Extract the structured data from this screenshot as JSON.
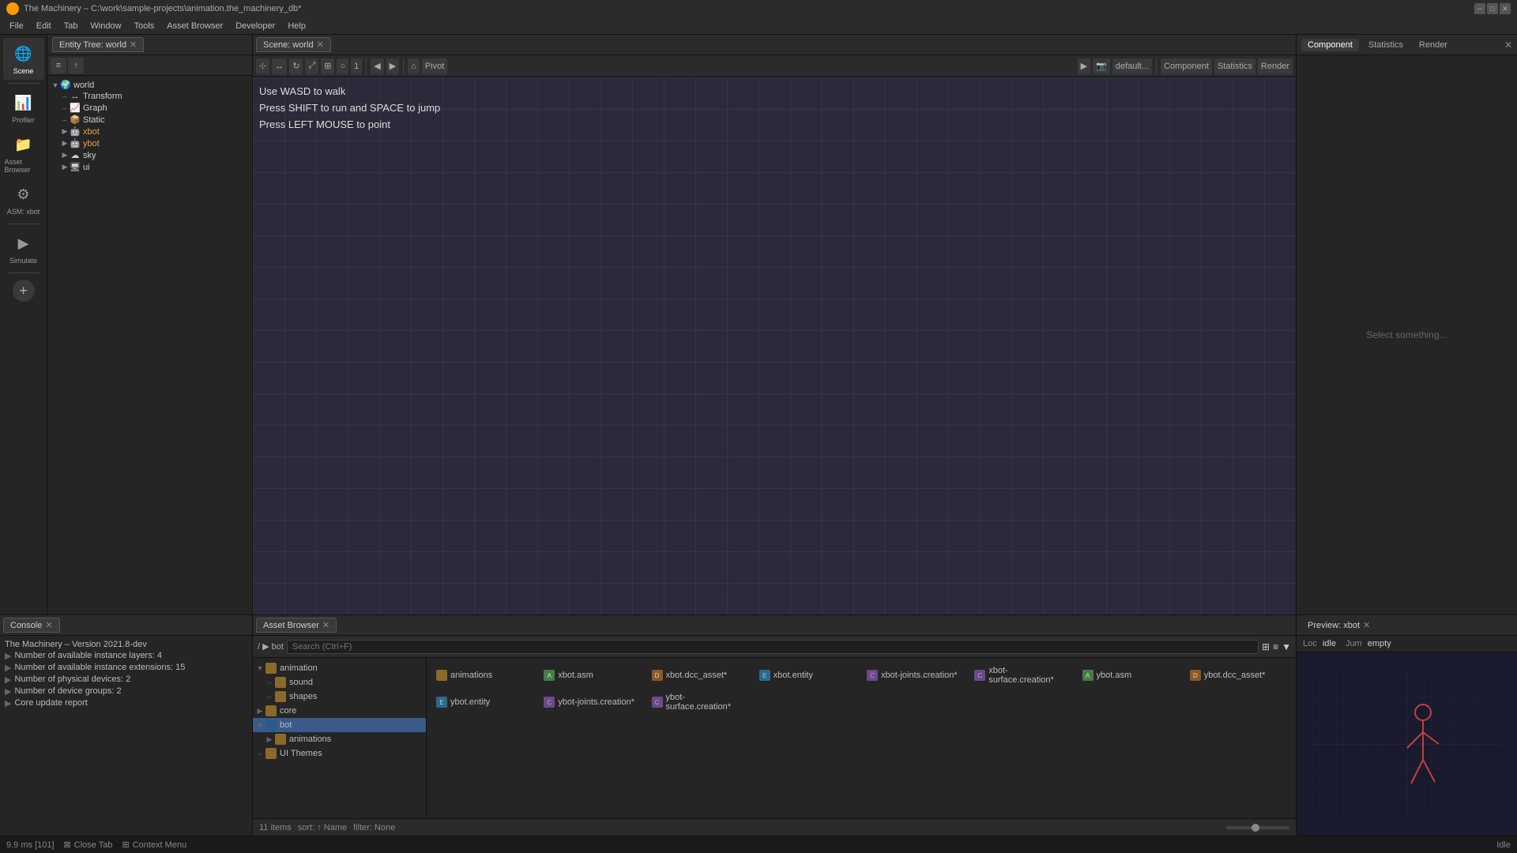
{
  "titlebar": {
    "title": "The Machinery – C:\\work\\sample-projects\\animation.the_machinery_db*",
    "min_btn": "─",
    "max_btn": "□",
    "close_btn": "✕"
  },
  "menubar": {
    "items": [
      "File",
      "Edit",
      "Tab",
      "Window",
      "Tools",
      "Asset Browser",
      "Developer",
      "Help"
    ]
  },
  "left_sidebar": {
    "icons": [
      {
        "id": "scene",
        "label": "Scene",
        "symbol": "🌐",
        "active": true
      },
      {
        "id": "profiler",
        "label": "Profiler",
        "symbol": "📊"
      },
      {
        "id": "asset-browser",
        "label": "Asset Browser",
        "symbol": "📁"
      },
      {
        "id": "asm",
        "label": "ASM: xbot",
        "symbol": "⚙"
      },
      {
        "id": "simulate",
        "label": "Simulate",
        "symbol": "▶"
      }
    ],
    "add_label": "+"
  },
  "entity_panel": {
    "tab_label": "Entity Tree: world",
    "tree": [
      {
        "label": "world",
        "level": 0,
        "expanded": true,
        "has_children": true,
        "icon": "🌍"
      },
      {
        "label": "Transform",
        "level": 1,
        "has_children": false,
        "icon": "↔"
      },
      {
        "label": "Graph",
        "level": 1,
        "has_children": false,
        "icon": "📈"
      },
      {
        "label": "Static",
        "level": 1,
        "has_children": false,
        "icon": "📦"
      },
      {
        "label": "xbot",
        "level": 1,
        "has_children": true,
        "icon": "🤖",
        "color": "#e8a040"
      },
      {
        "label": "ybot",
        "level": 1,
        "has_children": true,
        "icon": "🤖",
        "color": "#e8a040"
      },
      {
        "label": "sky",
        "level": 1,
        "has_children": false,
        "icon": "☁"
      },
      {
        "label": "ui",
        "level": 1,
        "has_children": false,
        "icon": "🖥"
      }
    ]
  },
  "viewport": {
    "tab_label": "Scene: world",
    "hints": [
      "Use WASD to walk",
      "Press SHIFT to run and SPACE to jump",
      "Press LEFT MOUSE to point"
    ],
    "pivot_label": "Pivot",
    "default_label": "default...",
    "layer_num": "1"
  },
  "right_panel": {
    "tabs": [
      "Component",
      "Statistics",
      "Render"
    ],
    "active_tab": "Component",
    "select_hint": "Select something..."
  },
  "bottom": {
    "console": {
      "tab_label": "Console",
      "lines": [
        "The Machinery – Version 2021.8-dev",
        "Number of available instance layers: 4",
        "Number of available instance extensions: 15",
        "Number of physical devices: 2",
        "Number of device groups: 2",
        "Core update report"
      ]
    },
    "asset_browser": {
      "tab_label": "Asset Browser",
      "breadcrumb": "/ ▶ bot",
      "search_placeholder": "Search (Ctrl+F)",
      "tree": [
        {
          "label": "animation",
          "level": 0,
          "expanded": true,
          "type": "folder"
        },
        {
          "label": "sound",
          "level": 1,
          "type": "folder"
        },
        {
          "label": "shapes",
          "level": 1,
          "type": "folder"
        },
        {
          "label": "core",
          "level": 0,
          "type": "folder"
        },
        {
          "label": "bot",
          "level": 0,
          "expanded": true,
          "type": "folder",
          "selected": true
        },
        {
          "label": "animations",
          "level": 1,
          "type": "folder",
          "expanded": true
        },
        {
          "label": "UI Themes",
          "level": 0,
          "type": "folder"
        }
      ],
      "files": [
        {
          "name": "animations",
          "type": "folder"
        },
        {
          "name": "xbot.asm",
          "type": "asm"
        },
        {
          "name": "xbot.dcc_asset*",
          "type": "dcc"
        },
        {
          "name": "xbot.entity",
          "type": "entity"
        },
        {
          "name": "xbot-joints.creation*",
          "type": "creation"
        },
        {
          "name": "xbot-surface.creation*",
          "type": "creation"
        },
        {
          "name": "ybot.asm",
          "type": "asm"
        },
        {
          "name": "ybot.dcc_asset*",
          "type": "dcc"
        },
        {
          "name": "ybot.entity",
          "type": "entity"
        },
        {
          "name": "ybot-joints.creation*",
          "type": "creation"
        },
        {
          "name": "ybot-surface.creation*",
          "type": "creation"
        }
      ],
      "status": {
        "count": "11 items",
        "sort": "sort: ↑ Name",
        "filter": "filter: None"
      }
    },
    "preview": {
      "tab_label": "Preview: xbot",
      "loc_label": "Loc",
      "loc_value": "idle",
      "jum_label": "Jum",
      "jum_value": "empty"
    }
  },
  "statusbar": {
    "timing": "9.9 ms [101]",
    "close_tab": "Close Tab",
    "context_menu": "Context Menu",
    "idle": "Idle"
  }
}
